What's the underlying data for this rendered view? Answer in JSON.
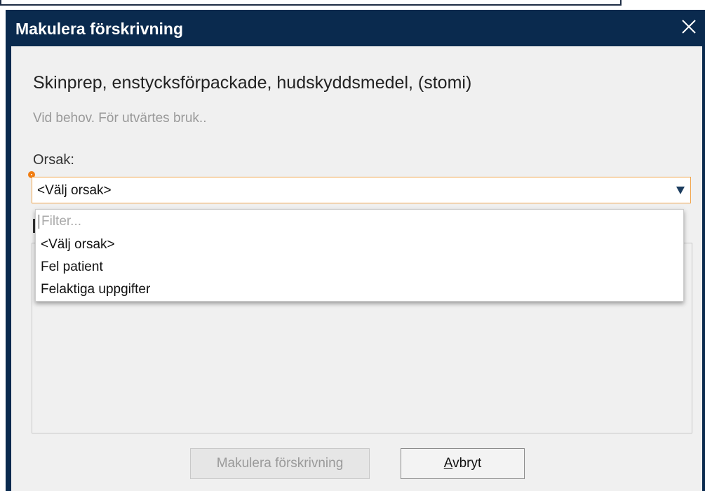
{
  "dialog": {
    "title": "Makulera förskrivning",
    "close_icon": "close-icon"
  },
  "prescription": {
    "product": "Skinprep, enstycksförpackade, hudskyddsmedel, (stomi)",
    "instructions": "Vid behov. För utvärtes bruk.."
  },
  "reason": {
    "label": "Orsak:",
    "selected": "<Välj orsak>",
    "filter_placeholder": "Filter...",
    "options": [
      {
        "label": "<Välj orsak>"
      },
      {
        "label": "Fel patient"
      },
      {
        "label": "Felaktiga uppgifter"
      }
    ]
  },
  "buttons": {
    "submit_label": "Makulera förskrivning",
    "cancel_first": "A",
    "cancel_rest": "vbryt"
  },
  "colors": {
    "titlebar": "#0a2a4e",
    "required": "#f07d12",
    "focus_border": "#f0a44a"
  }
}
